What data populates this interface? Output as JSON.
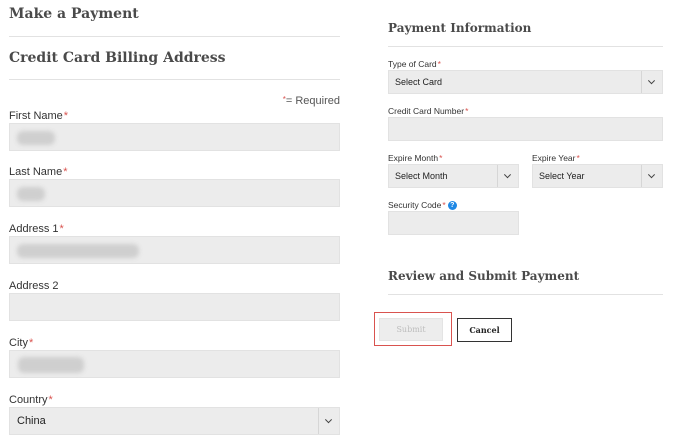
{
  "left": {
    "page_title": "Make a Payment",
    "section_title": "Credit Card Billing Address",
    "required_marker": "*",
    "required_text": "= Required",
    "fields": {
      "first_name": "First Name",
      "last_name": "Last Name",
      "address1": "Address 1",
      "address2": "Address 2",
      "city": "City",
      "country": "Country"
    },
    "country_value": "China"
  },
  "right": {
    "payment_info_title": "Payment Information",
    "type_of_card_label": "Type of Card",
    "type_of_card_value": "Select Card",
    "card_number_label": "Credit Card Number",
    "expire_month_label": "Expire Month",
    "expire_month_value": "Select Month",
    "expire_year_label": "Expire Year",
    "expire_year_value": "Select Year",
    "security_code_label": "Security Code",
    "help_icon": "?",
    "review_title": "Review and Submit Payment",
    "submit_label": "Submit",
    "cancel_label": "Cancel"
  },
  "asterisk": "*",
  "colors": {
    "required": "#d9534f",
    "help_icon": "#1e88e5",
    "highlight": "#d9534f",
    "field_bg": "#ececec"
  }
}
